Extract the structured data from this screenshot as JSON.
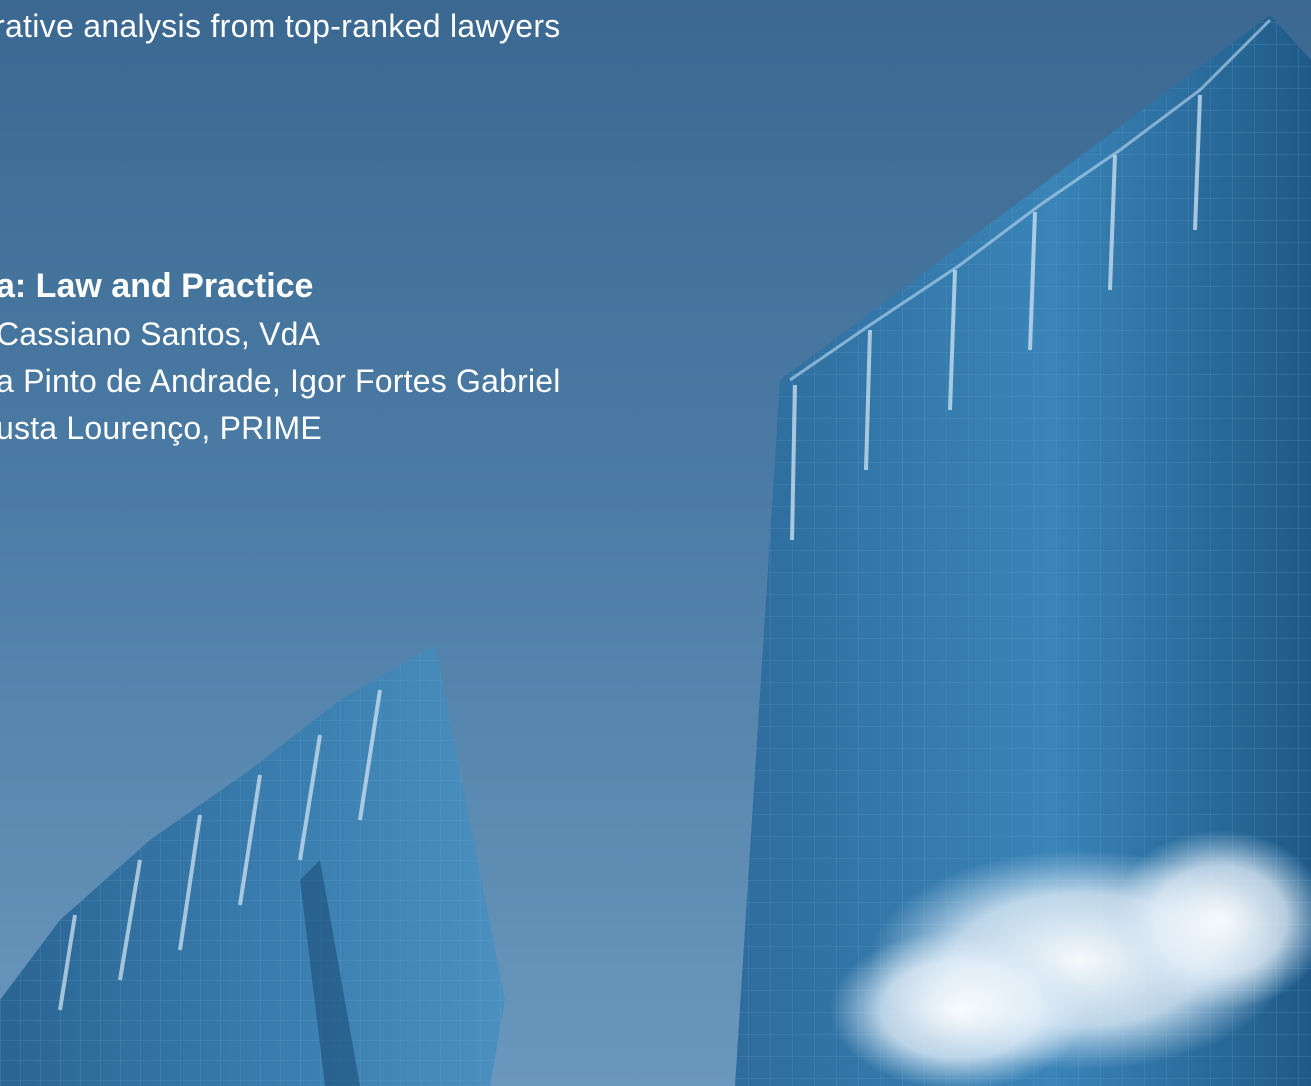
{
  "header": {
    "subtitle": "rative analysis from top-ranked lawyers"
  },
  "chapter": {
    "title": "a: Law and Practice",
    "authors": [
      "Cassiano Santos, VdA",
      "a Pinto de Andrade, Igor Fortes Gabriel",
      "usta Lourenço, PRIME"
    ]
  },
  "colors": {
    "sky": "#4a7aa3",
    "text": "#ffffff",
    "glass": "#2f6f9e"
  },
  "background_image": "skyscraper-photo"
}
